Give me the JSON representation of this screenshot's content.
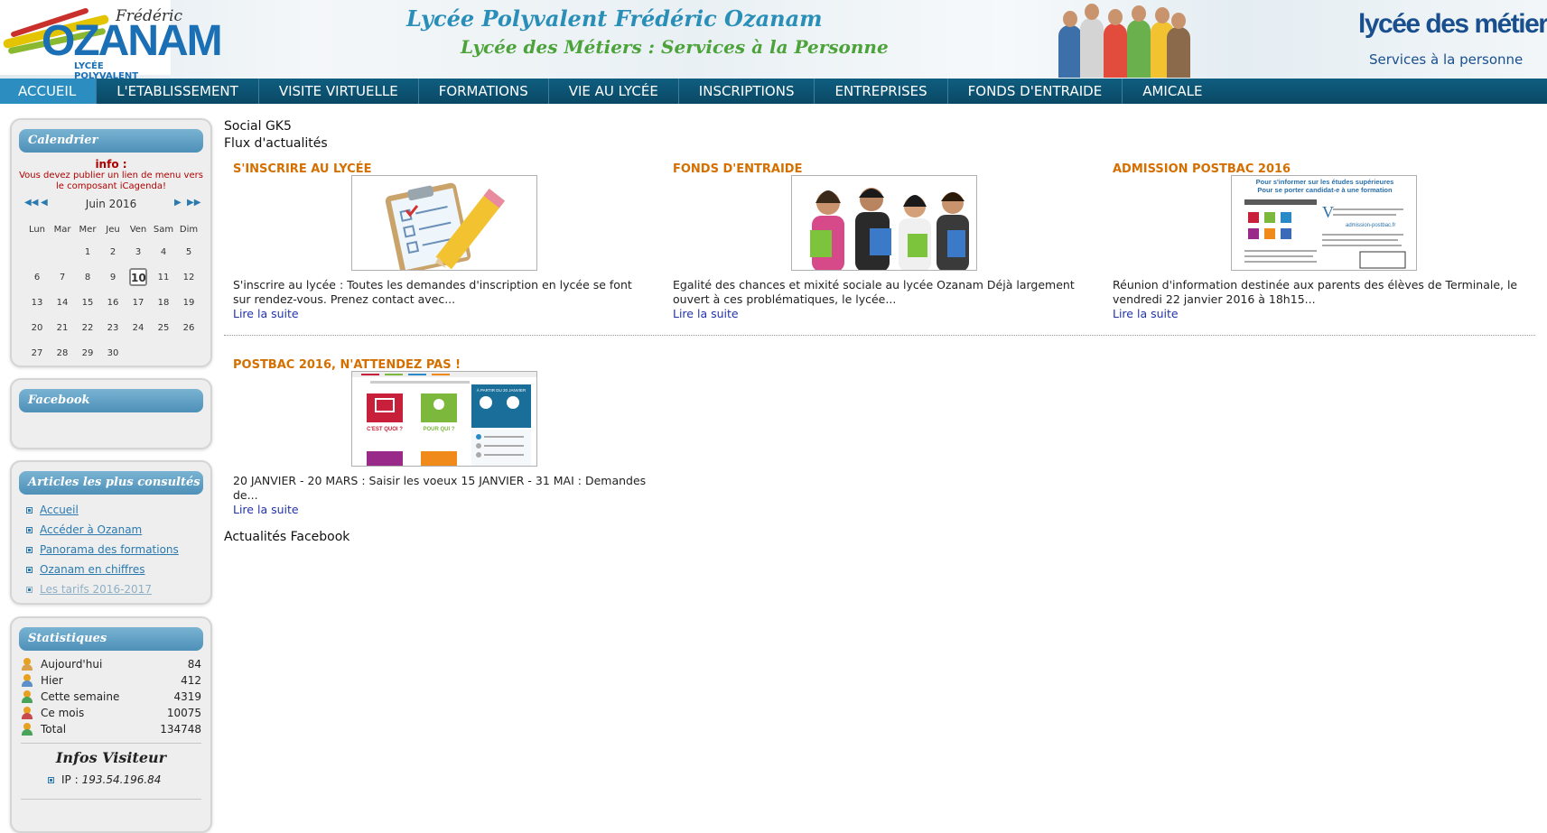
{
  "header": {
    "logo": {
      "frederic": "Frédéric",
      "ozanam": "OZANAM",
      "subtitle": "LYCÉE POLYVALENT"
    },
    "title": "Lycée Polyvalent Frédéric Ozanam",
    "subtitle": "Lycée des Métiers : Services à la Personne",
    "metiers_logo": {
      "line1": "lycée des métiers",
      "line2": "Services à la personne"
    }
  },
  "nav": {
    "items": [
      "ACCUEIL",
      "L'ETABLISSEMENT",
      "VISITE VIRTUELLE",
      "FORMATIONS",
      "VIE AU LYCÉE",
      "INSCRIPTIONS",
      "ENTREPRISES",
      "FONDS D'ENTRAIDE",
      "AMICALE"
    ],
    "active": "ACCUEIL"
  },
  "sidebar": {
    "calendar": {
      "title": "Calendrier",
      "info_title": "info :",
      "info_text": "Vous devez publier un lien de menu vers le composant iCagenda!",
      "month": "Juin 2016",
      "days": [
        "Lun",
        "Mar",
        "Mer",
        "Jeu",
        "Ven",
        "Sam",
        "Dim"
      ],
      "weeks": [
        [
          "",
          "",
          "1",
          "2",
          "3",
          "4",
          "5"
        ],
        [
          "6",
          "7",
          "8",
          "9",
          "10",
          "11",
          "12"
        ],
        [
          "13",
          "14",
          "15",
          "16",
          "17",
          "18",
          "19"
        ],
        [
          "20",
          "21",
          "22",
          "23",
          "24",
          "25",
          "26"
        ],
        [
          "27",
          "28",
          "29",
          "30",
          "",
          "",
          ""
        ]
      ],
      "today": "10"
    },
    "facebook": {
      "title": "Facebook"
    },
    "articles": {
      "title": "Articles les plus consultés",
      "items": [
        "Accueil",
        "Accéder à Ozanam",
        "Panorama des formations",
        "Ozanam en chiffres",
        "Les tarifs 2016-2017"
      ]
    },
    "stats": {
      "title": "Statistiques",
      "rows": [
        {
          "label": "Aujourd'hui",
          "value": "84",
          "color": "#d9a24a"
        },
        {
          "label": "Hier",
          "value": "412",
          "color": "#5e8fc8"
        },
        {
          "label": "Cette semaine",
          "value": "4319",
          "color": "#4aa35a"
        },
        {
          "label": "Ce mois",
          "value": "10075",
          "color": "#c94a4a"
        },
        {
          "label": "Total",
          "value": "134748",
          "color": "#4aa35a"
        }
      ],
      "visitor_title": "Infos Visiteur",
      "ip_label": "IP :",
      "ip_value": "193.54.196.84"
    }
  },
  "main": {
    "heading": "Social GK5",
    "subheading": "Flux d'actualités",
    "news": [
      {
        "title": "S'INSCRIRE AU LYCÉE",
        "text": "  S'inscrire au lycée :     Toutes les demandes d'inscription en lycée se font sur rendez-vous. Prenez contact avec...",
        "more": "Lire la suite"
      },
      {
        "title": "FONDS D'ENTRAIDE",
        "text": "Egalité des chances et mixité sociale au lycée Ozanam     Déjà largement ouvert à ces problématiques, le lycée...",
        "more": "Lire la suite"
      },
      {
        "title": "ADMISSION POSTBAC 2016",
        "text": "Réunion d'information destinée aux parents des élèves de Terminale, le vendredi 22 janvier 2016 à 18h15...",
        "more": "Lire la suite"
      },
      {
        "title": "POSTBAC 2016, N'ATTENDEZ PAS !",
        "text": "  20 JANVIER - 20 MARS : Saisir les voeux 15 JANVIER - 31 MAI : Demandes de...",
        "more": "Lire la suite"
      }
    ],
    "postbac_thumb": {
      "line1": "Pour s'informer sur les études supérieures",
      "line2": "Pour se porter candidat-e à une formation",
      "site": "admission-postbac.fr"
    },
    "postbac2_thumb": {
      "tile1": "C'EST QUOI ?",
      "tile2": "POUR QUI ?",
      "side_title": "À PARTIR DU 20 JANVIER"
    },
    "facebook_heading": "Actualités Facebook"
  },
  "colors": {
    "nav_bg": "#0a4865",
    "nav_active": "#2c8ec0",
    "news_title": "#d46f00",
    "link": "#2233aa",
    "module_title": "#4e90b8"
  }
}
